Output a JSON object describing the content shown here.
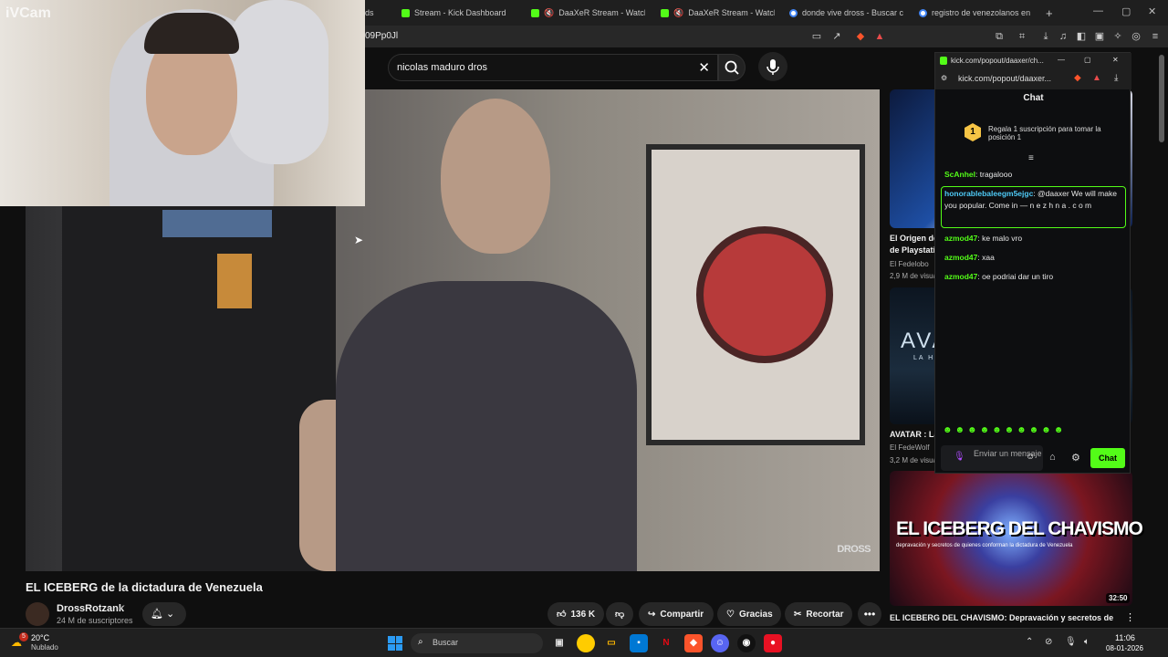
{
  "browser": {
    "tabs": [
      {
        "title": "ds",
        "icon": "kick"
      },
      {
        "title": "Stream - Kick Dashboard",
        "icon": "kick"
      },
      {
        "title": "DaaXeR Stream - Watch Li",
        "icon": "kick",
        "muted": true
      },
      {
        "title": "DaaXeR Stream - Watch Li",
        "icon": "kick",
        "muted": true
      },
      {
        "title": "donde vive dross - Buscar con",
        "icon": "google"
      },
      {
        "title": "registro de venezolanos en ch",
        "icon": "google"
      }
    ],
    "new_tab": "+",
    "url_fragment": "09Pp0Jl"
  },
  "overlay": {
    "label": "iVCam"
  },
  "youtube": {
    "search_query": "nicolas maduro dros",
    "video": {
      "title": "EL ICEBERG de la dictadura de Venezuela",
      "watermark": "DROSS"
    },
    "channel": {
      "name": "DrossRotzank",
      "subscribers": "24 M de suscriptores"
    },
    "actions": {
      "likes": "136 K",
      "share": "Compartir",
      "thanks": "Gracias",
      "clip": "Recortar"
    },
    "recommendations": [
      {
        "title": "El Origen de",
        "title2": "de Playstatio",
        "channel": "El Fedelobo",
        "views": "2,9 M de visua"
      },
      {
        "title": "AVATAR : La",
        "thumb_text": "AVA",
        "thumb_sub": "LA H",
        "channel": "El FedeWolf",
        "views": "3,2 M de visua"
      },
      {
        "title": "EL ICEBERG DEL CHAVISMO: Depravación y secretos de",
        "thumb_text": "EL ICEBERG DEL CHAVISMO",
        "thumb_sub": "depravación y secretos de quienes conforman la dictadura de Venezuela",
        "duration": "32:50"
      }
    ]
  },
  "kick_popout": {
    "window_title": "kick.com/popout/daaxer/ch...",
    "url": "kick.com/popout/daaxer...",
    "chat_title": "Chat",
    "gift": {
      "rank": "1",
      "text": "Regala 1 suscripción para tomar la posición 1"
    },
    "messages": [
      {
        "user": "ScAnhel",
        "text": "tragalooo"
      },
      {
        "user": "honorablebaleegm5ejgc",
        "text": "@daaxer We will make you popular. Come in — n e z h n a . c o m"
      },
      {
        "user": "azmod47",
        "text": "ke malo vro"
      },
      {
        "user": "azmod47",
        "text": "xaa"
      },
      {
        "user": "azmod47",
        "text": "oe podriai dar un tiro"
      }
    ],
    "input_placeholder": "Enviar un mensaje",
    "send_label": "Chat"
  },
  "taskbar": {
    "weather": {
      "temp": "20°C",
      "condition": "Nublado",
      "badge": "5"
    },
    "search_placeholder": "Buscar",
    "time": "11:06",
    "date": "08-01-2026"
  }
}
